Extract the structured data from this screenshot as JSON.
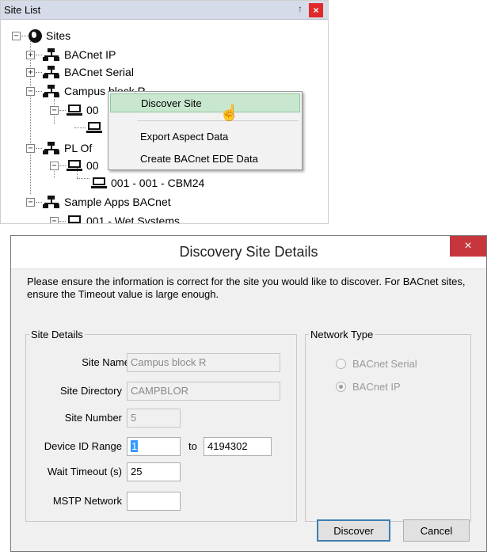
{
  "site_list": {
    "title": "Site List",
    "pin_glyph": "↑",
    "close_glyph": "×",
    "tree": [
      {
        "label": "Sites"
      },
      {
        "label": "BACnet IP"
      },
      {
        "label": "BACnet Serial"
      },
      {
        "label": "Campus block R"
      },
      {
        "label": "00"
      },
      {
        "label": ""
      },
      {
        "label": "PL Of"
      },
      {
        "label": "00"
      },
      {
        "label": "001 - 001 - CBM24"
      },
      {
        "label": "Sample Apps BACnet"
      },
      {
        "label": "001 - Wet Systems"
      }
    ]
  },
  "context_menu": {
    "items": [
      {
        "label": "Discover Site"
      },
      {
        "label": "Export Aspect Data"
      },
      {
        "label": "Create BACnet EDE Data"
      }
    ]
  },
  "dialog": {
    "title": "Discovery Site Details",
    "close_glyph": "×",
    "instructions": "Please ensure the information is correct for the site you would like to discover. For BACnet sites, ensure the Timeout value is large enough.",
    "site_details": {
      "legend": "Site Details",
      "site_name_label": "Site Name",
      "site_name_value": "Campus block R",
      "site_directory_label": "Site Directory",
      "site_directory_value": "CAMPBLOR",
      "site_number_label": "Site Number",
      "site_number_value": "5",
      "device_id_range_label": "Device ID Range",
      "device_id_from": "1",
      "to_label": "to",
      "device_id_to": "4194302",
      "wait_timeout_label": "Wait Timeout (s)",
      "wait_timeout_value": "25",
      "mstp_network_label": "MSTP Network",
      "mstp_network_value": ""
    },
    "network_type": {
      "legend": "Network Type",
      "options": [
        {
          "label": "BACnet Serial",
          "checked": false
        },
        {
          "label": "BACnet IP",
          "checked": true
        }
      ]
    },
    "buttons": {
      "discover": "Discover",
      "cancel": "Cancel"
    }
  }
}
